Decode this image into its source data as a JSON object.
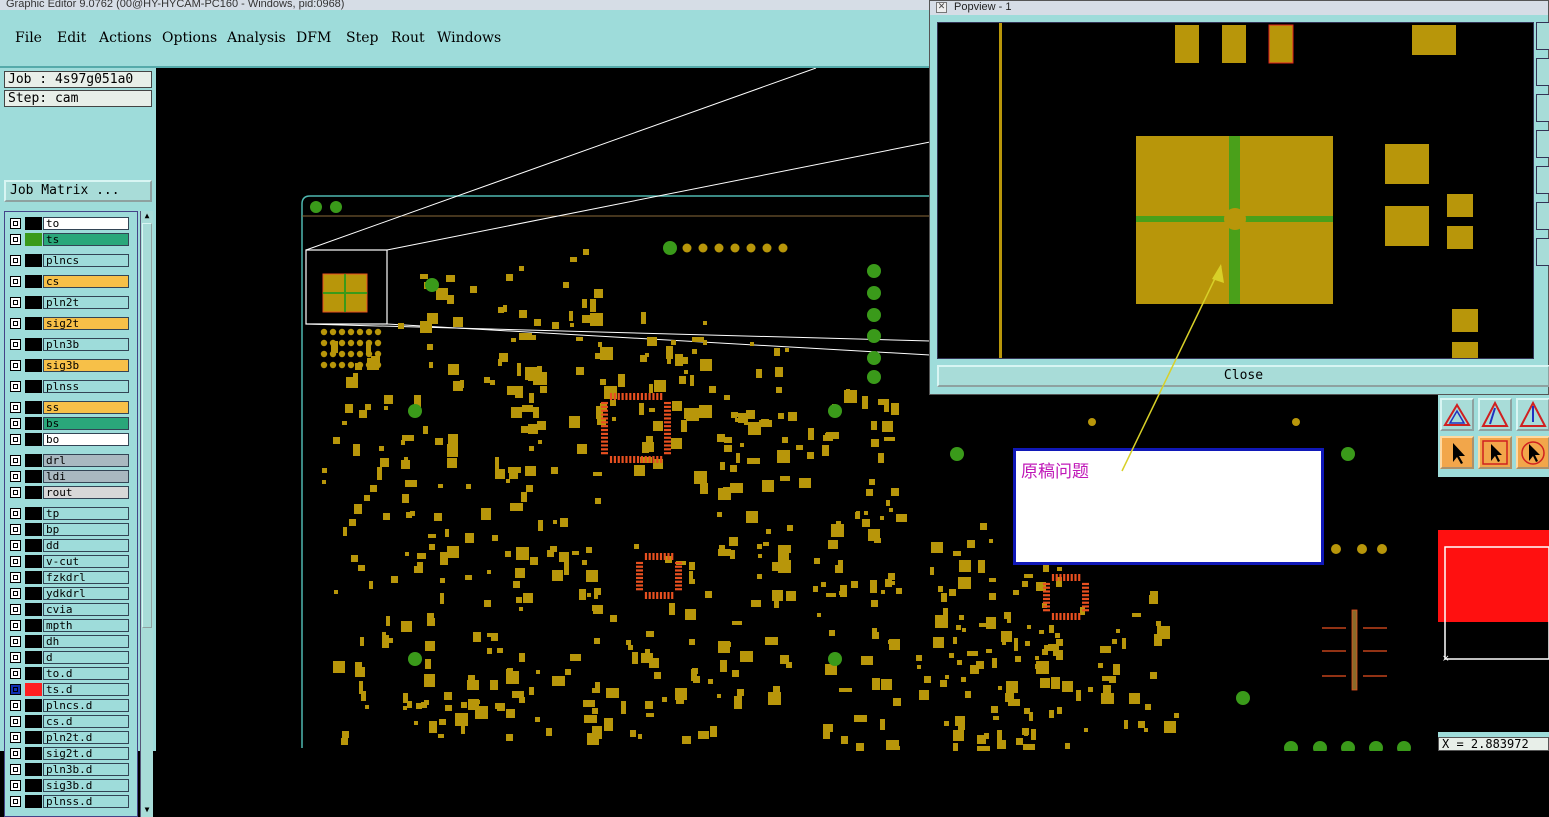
{
  "window": {
    "title": "Graphic Editor 9.0762 (00@HY-HYCAM-PC160 - Windows, pid:0968)"
  },
  "menu": [
    {
      "label": "File",
      "name": "menu-file"
    },
    {
      "label": "Edit",
      "name": "menu-edit"
    },
    {
      "label": "Actions",
      "name": "menu-actions"
    },
    {
      "label": "Options",
      "name": "menu-options"
    },
    {
      "label": "Analysis",
      "name": "menu-analysis"
    },
    {
      "label": "DFM",
      "name": "menu-dfm"
    },
    {
      "label": "Step",
      "name": "menu-step"
    },
    {
      "label": "Rout",
      "name": "menu-rout"
    },
    {
      "label": "Windows",
      "name": "menu-windows"
    }
  ],
  "job": {
    "label": "Job : 4s97g051a0",
    "step": "Step: cam",
    "matrix_button": "Job Matrix ..."
  },
  "colors": {
    "panel": "#9edcda",
    "copper": "#b8960a",
    "green_pad": "#3a9a1a",
    "smd_red": "#e85020",
    "note_border": "#1018b8",
    "note_text": "#c018b8"
  },
  "layers": [
    {
      "name": "to",
      "bg": "#ffffff",
      "sw": "#000000"
    },
    {
      "name": "ts",
      "bg": "#2aa77a",
      "sw": "#3a9a1a"
    },
    {
      "name": "plncs",
      "bg": "#9edcda",
      "sw": "#000000",
      "gap": true
    },
    {
      "name": "cs",
      "bg": "#f7c048",
      "sw": "#000000",
      "gap": true
    },
    {
      "name": "pln2t",
      "bg": "#9edcda",
      "sw": "#000000",
      "gap": true
    },
    {
      "name": "sig2t",
      "bg": "#f7c048",
      "sw": "#000000",
      "gap": true
    },
    {
      "name": "pln3b",
      "bg": "#9edcda",
      "sw": "#000000",
      "gap": true
    },
    {
      "name": "sig3b",
      "bg": "#f7c048",
      "sw": "#000000",
      "gap": true
    },
    {
      "name": "plnss",
      "bg": "#9edcda",
      "sw": "#000000",
      "gap": true
    },
    {
      "name": "ss",
      "bg": "#f7c048",
      "sw": "#000000",
      "gap": true
    },
    {
      "name": "bs",
      "bg": "#2aa77a",
      "sw": "#000000"
    },
    {
      "name": "bo",
      "bg": "#ffffff",
      "sw": "#000000"
    },
    {
      "name": "drl",
      "bg": "#a9b8c0",
      "sw": "#000000",
      "gap": true
    },
    {
      "name": "ldi",
      "bg": "#a9b8c0",
      "sw": "#000000"
    },
    {
      "name": "rout",
      "bg": "#d8d8d8",
      "sw": "#000000"
    },
    {
      "name": "tp",
      "bg": "#9edcda",
      "sw": "#000000",
      "gap": true
    },
    {
      "name": "bp",
      "bg": "#9edcda",
      "sw": "#000000"
    },
    {
      "name": "dd",
      "bg": "#9edcda",
      "sw": "#000000"
    },
    {
      "name": "v-cut",
      "bg": "#9edcda",
      "sw": "#000000"
    },
    {
      "name": "fzkdrl",
      "bg": "#9edcda",
      "sw": "#000000"
    },
    {
      "name": "ydkdrl",
      "bg": "#9edcda",
      "sw": "#000000"
    },
    {
      "name": "cvia",
      "bg": "#9edcda",
      "sw": "#000000"
    },
    {
      "name": "mpth",
      "bg": "#9edcda",
      "sw": "#000000"
    },
    {
      "name": "dh",
      "bg": "#9edcda",
      "sw": "#000000"
    },
    {
      "name": "d",
      "bg": "#9edcda",
      "sw": "#000000"
    },
    {
      "name": "to.d",
      "bg": "#9edcda",
      "sw": "#000000"
    },
    {
      "name": "ts.d",
      "bg": "#9edcda",
      "sw": "#ff2020",
      "active": true
    },
    {
      "name": "plncs.d",
      "bg": "#9edcda",
      "sw": "#000000"
    },
    {
      "name": "cs.d",
      "bg": "#9edcda",
      "sw": "#000000"
    },
    {
      "name": "pln2t.d",
      "bg": "#9edcda",
      "sw": "#000000"
    },
    {
      "name": "sig2t.d",
      "bg": "#9edcda",
      "sw": "#000000"
    },
    {
      "name": "pln3b.d",
      "bg": "#9edcda",
      "sw": "#000000"
    },
    {
      "name": "sig3b.d",
      "bg": "#9edcda",
      "sw": "#000000"
    },
    {
      "name": "plnss.d",
      "bg": "#9edcda",
      "sw": "#000000"
    }
  ],
  "popview": {
    "title": "Popview - 1",
    "close_label": "Close"
  },
  "note": {
    "text": "原稿问题"
  },
  "status": {
    "coord": "X = 2.883972"
  },
  "icons": [
    "close-x-icon",
    "arrow-select-icon",
    "triangle-tool-icon"
  ]
}
